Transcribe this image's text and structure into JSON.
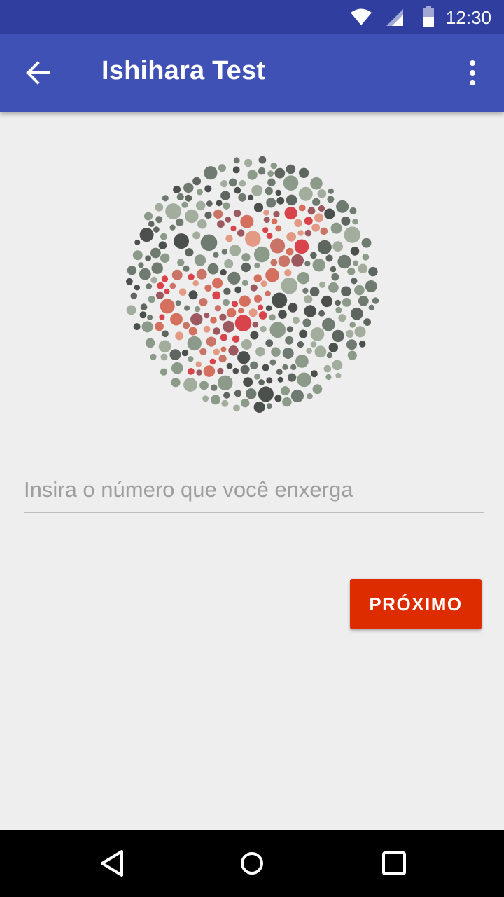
{
  "status_bar": {
    "time": "12:30",
    "icons": [
      "wifi-icon",
      "cell-signal-icon",
      "battery-icon"
    ]
  },
  "app_bar": {
    "title": "Ishihara Test",
    "navigation_icon": "arrow-back-icon",
    "menu_icon": "more-vert-icon"
  },
  "plate": {
    "description_icon": "ishihara-plate",
    "colors": {
      "background_dots": [
        "#4b504c",
        "#6f7a70",
        "#8c9a8a",
        "#a3ad9e",
        "#5e665f"
      ],
      "figure_dots": [
        "#d9434b",
        "#e39a84",
        "#c97467",
        "#9c5a60",
        "#d56f5e"
      ]
    }
  },
  "answer": {
    "placeholder": "Insira o número que você enxerga",
    "value": ""
  },
  "next_button": {
    "label": "PRÓXIMO"
  },
  "nav_bar": {
    "icons": [
      "nav-back-icon",
      "nav-home-icon",
      "nav-recents-icon"
    ]
  },
  "colors": {
    "primary": "#3f51b5",
    "primary_dark": "#303f9f",
    "accent": "#dd2c00",
    "background": "#eeeeee"
  }
}
